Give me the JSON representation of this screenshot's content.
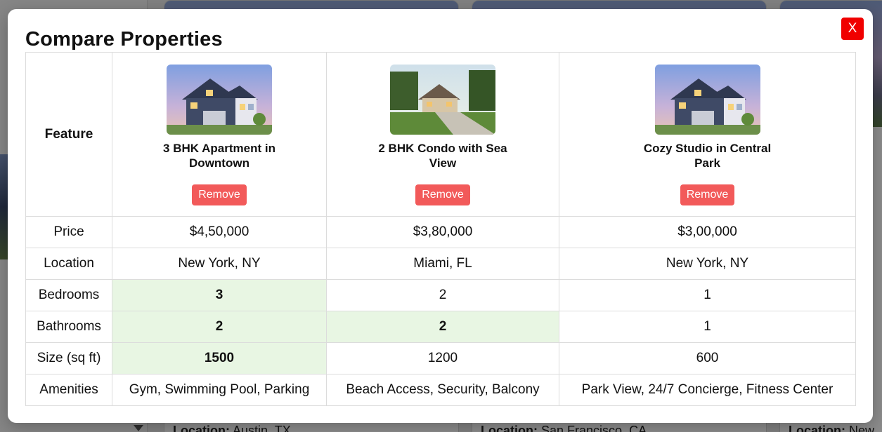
{
  "modal": {
    "title": "Compare Properties",
    "close_label": "X",
    "feature_header": "Feature",
    "remove_label": "Remove",
    "properties": [
      {
        "name": "3 BHK Apartment in Downtown",
        "image": "house-photo"
      },
      {
        "name": "2 BHK Condo with Sea View",
        "image": "house-photo"
      },
      {
        "name": "Cozy Studio in Central Park",
        "image": "house-photo"
      }
    ],
    "rows": [
      {
        "feature": "Price",
        "values": [
          "$4,50,000",
          "$3,80,000",
          "$3,00,000"
        ],
        "highlight": [
          false,
          false,
          false
        ]
      },
      {
        "feature": "Location",
        "values": [
          "New York, NY",
          "Miami, FL",
          "New York, NY"
        ],
        "highlight": [
          false,
          false,
          false
        ]
      },
      {
        "feature": "Bedrooms",
        "values": [
          "3",
          "2",
          "1"
        ],
        "highlight": [
          true,
          false,
          false
        ]
      },
      {
        "feature": "Bathrooms",
        "values": [
          "2",
          "2",
          "1"
        ],
        "highlight": [
          true,
          true,
          false
        ]
      },
      {
        "feature": "Size (sq ft)",
        "values": [
          "1500",
          "1200",
          "600"
        ],
        "highlight": [
          true,
          false,
          false
        ]
      },
      {
        "feature": "Amenities",
        "values": [
          "Gym, Swimming Pool, Parking",
          "Beach Access, Security, Balcony",
          "Park View, 24/7 Concierge, Fitness Center"
        ],
        "highlight": [
          false,
          false,
          false
        ]
      }
    ]
  },
  "background": {
    "location_label": "Location:",
    "cards": [
      {
        "location": "Austin, TX"
      },
      {
        "location": "San Francisco, CA"
      },
      {
        "location": "New"
      }
    ]
  },
  "colors": {
    "close_button": "#f00000",
    "remove_button": "#f25a5a",
    "best_value_highlight": "#e8f6e3"
  }
}
